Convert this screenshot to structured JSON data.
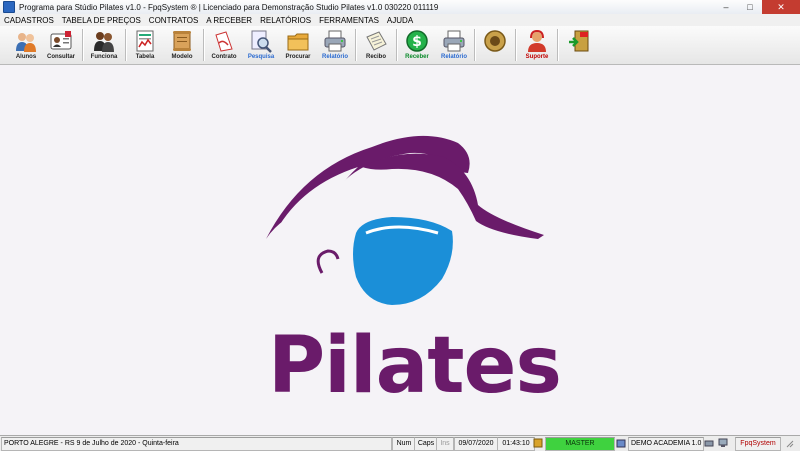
{
  "window": {
    "title": "Programa para Stúdio Pilates v1.0 - FpqSystem ® | Licenciado para  Demonstração Studio Pilates v1.0 030220 011119",
    "minimize": "–",
    "maximize": "□",
    "close": "✕"
  },
  "menu": [
    "CADASTROS",
    "TABELA DE PREÇOS",
    "CONTRATOS",
    "A RECEBER",
    "RELATÓRIOS",
    "FERRAMENTAS",
    "AJUDA"
  ],
  "toolbar": {
    "alunos": "Alunos",
    "consultar": "Consultar",
    "funciona": "Funciona",
    "tabela": "Tabela",
    "modelo": "Modelo",
    "contrato": "Contrato",
    "pesquisa": "Pesquisa",
    "procurar": "Procurar",
    "relatorio1": "Relatório",
    "recibo": "Recibo",
    "receber": "Receber",
    "relatorio2": "Relatório",
    "suporte": "Suporte",
    "pesquisa_color": "#2a6ad0",
    "relatorio_color": "#2a6ad0",
    "receber_color": "#0a8a2a",
    "suporte_color": "#c00000"
  },
  "logo": {
    "word": "Pilates",
    "purple": "#6a1b6a",
    "blue": "#1b8fd8"
  },
  "status": {
    "location": "PORTO ALEGRE - RS   9 de Julho de 2020 - Quinta-feira",
    "num": "Num",
    "caps": "Caps",
    "ins": "Ins",
    "date": "09/07/2020",
    "time": "01:43:10",
    "user": "MASTER",
    "company": "DEMO ACADEMIA 1.0",
    "brand": "FpqSystem"
  }
}
